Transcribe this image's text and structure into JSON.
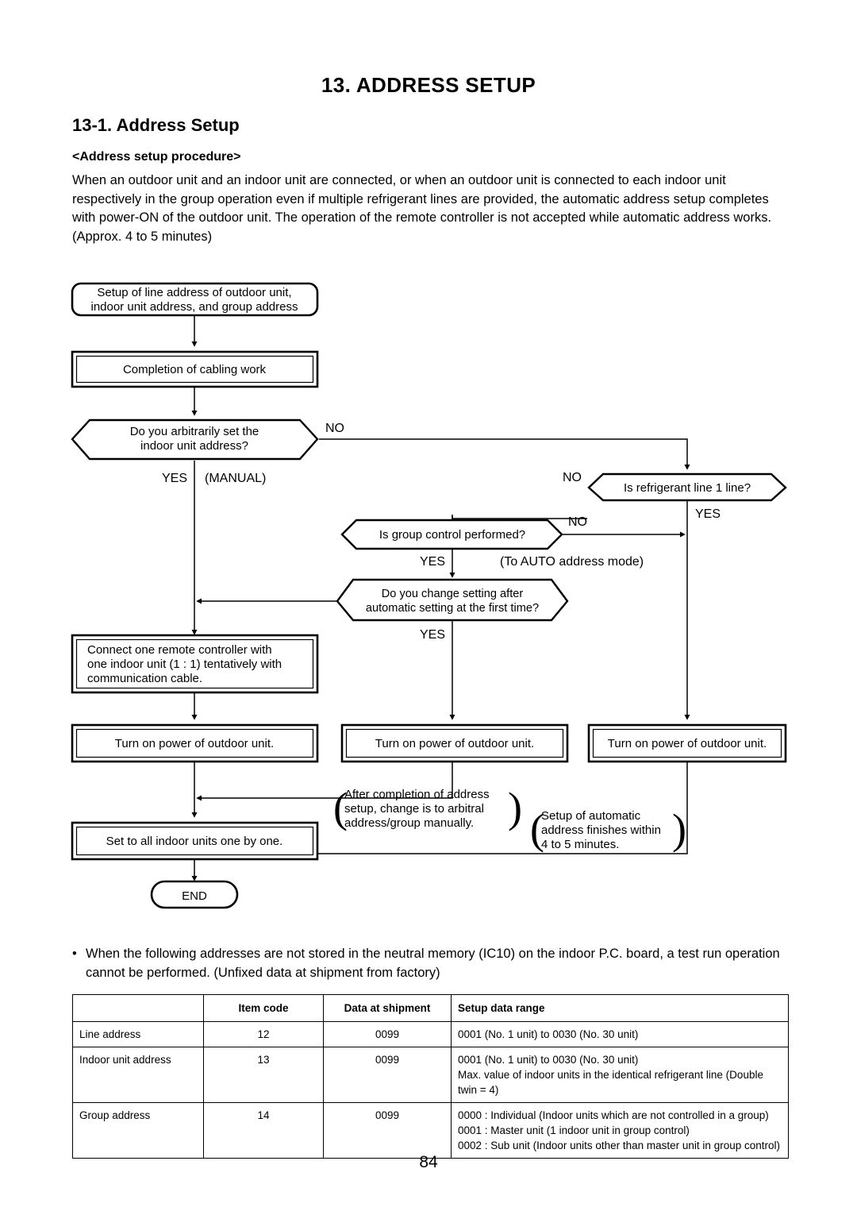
{
  "document": {
    "chapter_title": "13.  ADDRESS SETUP",
    "section_title": "13-1.  Address Setup",
    "sub_title": "<Address setup procedure>",
    "intro_paragraph": "When an outdoor unit and an indoor unit are connected, or when an outdoor unit is connected to each indoor unit respectively in the group operation even if multiple refrigerant lines are provided, the automatic address setup completes with power-ON of the outdoor unit. The operation of the remote controller is not accepted while automatic address works. (Approx. 4 to 5 minutes)",
    "page_number": "84"
  },
  "flowchart": {
    "nodes": {
      "start": {
        "shape": "rounded-rect",
        "line1": "Setup of line address of outdoor unit,",
        "line2": "indoor unit address, and group address"
      },
      "cabling": {
        "shape": "double-rect",
        "line1": "Completion of cabling work"
      },
      "decision_arbitrary": {
        "shape": "hexagon",
        "line1": "Do you arbitrarily set the",
        "line2": "indoor unit address?"
      },
      "decision_refrigerant": {
        "shape": "hexagon",
        "line1": "Is refrigerant line 1 line?"
      },
      "decision_group": {
        "shape": "hexagon",
        "line1": "Is group control performed?"
      },
      "decision_change": {
        "shape": "hexagon",
        "line1": "Do you change setting after",
        "line2": "automatic setting at the first time?"
      },
      "connect_rc": {
        "shape": "double-rect",
        "line1": "Connect one remote controller with",
        "line2": "one indoor unit (1 : 1) tentatively with",
        "line3": "communication cable."
      },
      "power_left": {
        "shape": "double-rect",
        "line1": "Turn on power of outdoor unit."
      },
      "power_mid": {
        "shape": "double-rect",
        "line1": "Turn on power of outdoor unit."
      },
      "power_right": {
        "shape": "double-rect",
        "line1": "Turn on power of outdoor unit."
      },
      "set_all": {
        "shape": "double-rect",
        "line1": "Set to all indoor units one by one."
      },
      "end": {
        "shape": "pill",
        "line1": "END"
      }
    },
    "edge_labels": {
      "arbitrary_no": "NO",
      "arbitrary_yes": "YES",
      "manual": "(MANUAL)",
      "refrigerant_no": "NO",
      "refrigerant_yes": "YES",
      "group_no": "NO",
      "group_yes": "YES",
      "auto_mode": "(To AUTO address mode)",
      "change_yes": "YES"
    },
    "annotations": {
      "manual_note": {
        "line1": "After completion of address",
        "line2": "setup, change is to arbitral",
        "line3": "address/group manually."
      },
      "auto_note": {
        "line1": "Setup of automatic",
        "line2": "address finishes within",
        "line3": "4 to 5 minutes."
      }
    }
  },
  "note": {
    "bullet": "•",
    "text": "When the following addresses are not stored in the neutral memory (IC10) on the indoor P.C. board, a test run operation cannot be performed. (Unfixed data at shipment from factory)"
  },
  "table": {
    "headers": [
      "",
      "Item code",
      "Data at shipment",
      "Setup data range"
    ],
    "rows": [
      {
        "label": "Line address",
        "item_code": "12",
        "data_at_shipment": "0099",
        "setup_data_range": [
          "0001 (No. 1 unit) to 0030 (No. 30 unit)"
        ]
      },
      {
        "label": "Indoor unit address",
        "item_code": "13",
        "data_at_shipment": "0099",
        "setup_data_range": [
          "0001 (No. 1 unit) to 0030 (No. 30 unit)",
          "Max. value of indoor units in the identical refrigerant line (Double twin = 4)"
        ]
      },
      {
        "label": "Group address",
        "item_code": "14",
        "data_at_shipment": "0099",
        "setup_data_range": [
          "0000 : Individual (Indoor units which are not controlled in a group)",
          "0001 : Master unit (1 indoor unit in group control)",
          "0002 : Sub unit (Indoor units other than master unit in group control)"
        ]
      }
    ]
  }
}
